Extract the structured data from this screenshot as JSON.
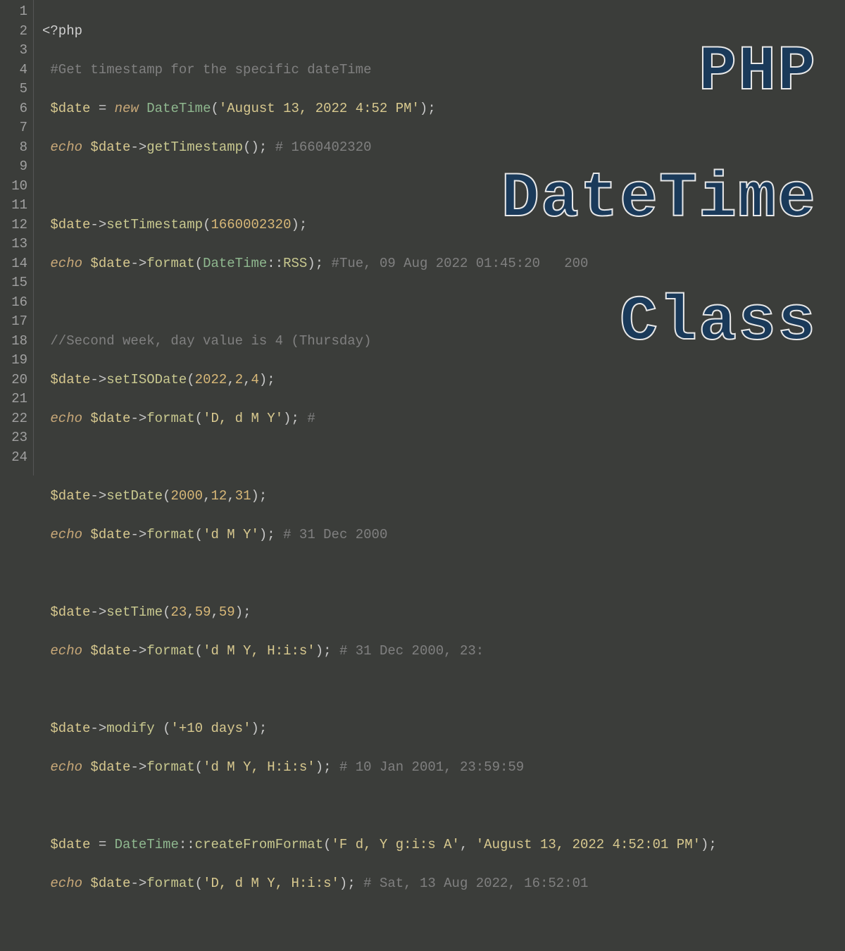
{
  "lineNumbers": [
    "1",
    "2",
    "3",
    "4",
    "5",
    "6",
    "7",
    "8",
    "9",
    "10",
    "11",
    "12",
    "13",
    "14",
    "15",
    "16",
    "17",
    "18",
    "19",
    "20",
    "21",
    "22",
    "23",
    "24"
  ],
  "code": {
    "l1": {
      "open": "<?php"
    },
    "l2": {
      "comment": "#Get timestamp for the specific dateTime"
    },
    "l3": {
      "var": "$date",
      "eq": " = ",
      "new": "new ",
      "cls": "DateTime",
      "p1": "(",
      "str": "'August 13, 2022 4:52 PM'",
      "p2": ");"
    },
    "l4": {
      "echo": "echo ",
      "var": "$date",
      "arrow": "->",
      "method": "getTimestamp",
      "call": "(); ",
      "comment": "# 1660402320"
    },
    "l6": {
      "var": "$date",
      "arrow": "->",
      "method": "setTimestamp",
      "p1": "(",
      "num": "1660002320",
      "p2": ");"
    },
    "l7": {
      "echo": "echo ",
      "var": "$date",
      "arrow": "->",
      "method": "format",
      "p1": "(",
      "cls": "DateTime",
      "scope": "::",
      "const": "RSS",
      "p2": "); ",
      "comment": "#Tue, 09 Aug 2022 01:45:20   200"
    },
    "l9": {
      "comment": "//Second week, day value is 4 (Thursday)"
    },
    "l10": {
      "var": "$date",
      "arrow": "->",
      "method": "setISODate",
      "p1": "(",
      "n1": "2022",
      "c1": ",",
      "n2": "2",
      "c2": ",",
      "n3": "4",
      "p2": ");"
    },
    "l11": {
      "echo": "echo ",
      "var": "$date",
      "arrow": "->",
      "method": "format",
      "p1": "(",
      "str": "'D, d M Y'",
      "p2": "); ",
      "comment": "#"
    },
    "l13": {
      "var": "$date",
      "arrow": "->",
      "method": "setDate",
      "p1": "(",
      "n1": "2000",
      "c1": ",",
      "n2": "12",
      "c2": ",",
      "n3": "31",
      "p2": ");"
    },
    "l14": {
      "echo": "echo ",
      "var": "$date",
      "arrow": "->",
      "method": "format",
      "p1": "(",
      "str": "'d M Y'",
      "p2": "); ",
      "comment": "# 31 Dec 2000"
    },
    "l16": {
      "var": "$date",
      "arrow": "->",
      "method": "setTime",
      "p1": "(",
      "n1": "23",
      "c1": ",",
      "n2": "59",
      "c2": ",",
      "n3": "59",
      "p2": ");"
    },
    "l17": {
      "echo": "echo ",
      "var": "$date",
      "arrow": "->",
      "method": "format",
      "p1": "(",
      "str": "'d M Y, H:i:s'",
      "p2": "); ",
      "comment": "# 31 Dec 2000, 23:"
    },
    "l19": {
      "var": "$date",
      "arrow": "->",
      "method": "modify ",
      "p1": "(",
      "str": "'+10 days'",
      "p2": ");"
    },
    "l20": {
      "echo": "echo ",
      "var": "$date",
      "arrow": "->",
      "method": "format",
      "p1": "(",
      "str": "'d M Y, H:i:s'",
      "p2": "); ",
      "comment": "# 10 Jan 2001, 23:59:59"
    },
    "l22": {
      "var": "$date",
      "eq": " = ",
      "cls": "DateTime",
      "scope": "::",
      "method": "createFromFormat",
      "p1": "(",
      "str1": "'F d, Y g:i:s A'",
      "c": ", ",
      "str2": "'August 13, 2022 4:52:01 PM'",
      "p2": ");"
    },
    "l23": {
      "echo": "echo ",
      "var": "$date",
      "arrow": "->",
      "method": "format",
      "p1": "(",
      "str": "'D, d M Y, H:i:s'",
      "p2": "); ",
      "comment": "# Sat, 13 Aug 2022, 16:52:01"
    }
  },
  "overlay": {
    "line1": "PHP",
    "line2": "DateTime",
    "line3": "Class"
  }
}
